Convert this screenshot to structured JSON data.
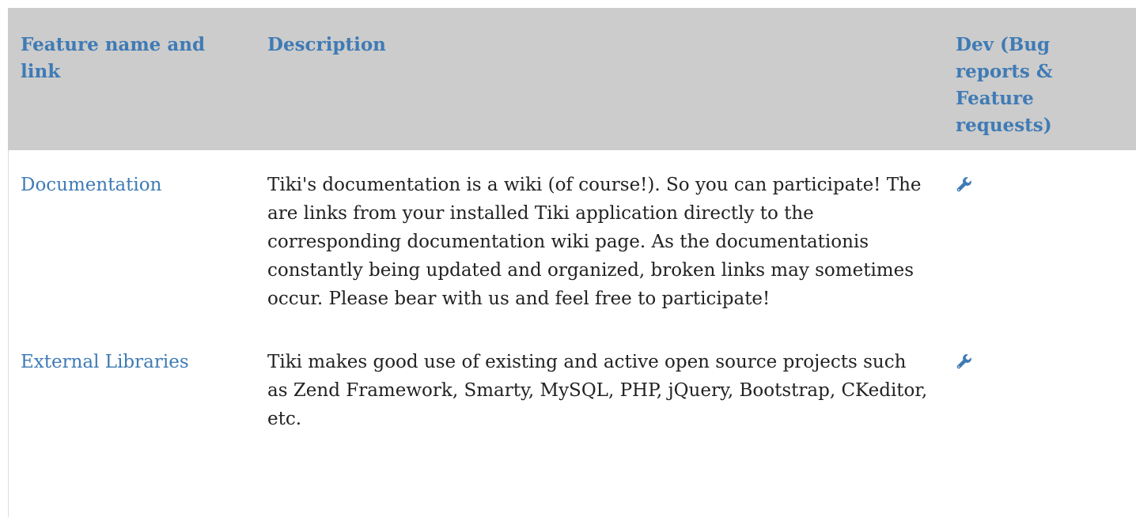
{
  "table": {
    "headers": {
      "name": "Feature name and link",
      "description": "Description",
      "dev": "Dev (Bug reports & Feature requests)"
    },
    "rows": [
      {
        "name": "Documentation",
        "description": "Tiki's documentation is a wiki (of course!). So you can participate! The are links from your installed Tiki application directly to the corresponding documentation wiki page. As the documentationis constantly being updated and organized, broken links may sometimes occur. Please bear with us and feel free to participate!",
        "dev_icon": "wrench-icon"
      },
      {
        "name": "External Libraries",
        "description": "Tiki makes good use of existing and active open source projects such as Zend Framework, Smarty, MySQL, PHP, jQuery, Bootstrap, CKeditor, etc.",
        "dev_icon": "wrench-icon"
      }
    ]
  },
  "colors": {
    "header_bg": "#cccccc",
    "link": "#3f7bb5",
    "text": "#222222"
  }
}
